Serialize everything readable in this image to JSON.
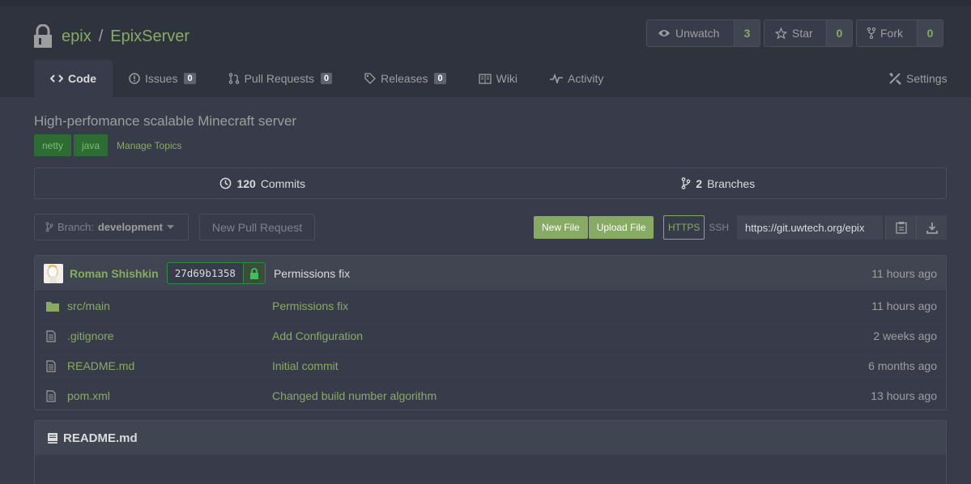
{
  "repo": {
    "owner": "epix",
    "separator": "/",
    "name": "EpixServer"
  },
  "actions": {
    "watch": {
      "label": "Unwatch",
      "count": "3"
    },
    "star": {
      "label": "Star",
      "count": "0"
    },
    "fork": {
      "label": "Fork",
      "count": "0"
    }
  },
  "tabs": [
    {
      "label": "Code"
    },
    {
      "label": "Issues",
      "badge": "0"
    },
    {
      "label": "Pull Requests",
      "badge": "0"
    },
    {
      "label": "Releases",
      "badge": "0"
    },
    {
      "label": "Wiki"
    },
    {
      "label": "Activity"
    },
    {
      "label": "Settings"
    }
  ],
  "description": "High-perfomance scalable Minecraft server",
  "topics": [
    "netty",
    "java"
  ],
  "manage_topics": "Manage Topics",
  "stats": {
    "commits_count": "120",
    "commits_label": "Commits",
    "branches_count": "2",
    "branches_label": "Branches"
  },
  "branch": {
    "prefix": "Branch:",
    "name": "development"
  },
  "new_pull_request": "New Pull Request",
  "file_buttons": {
    "new_file": "New File",
    "upload_file": "Upload File"
  },
  "clone": {
    "https": "HTTPS",
    "ssh": "SSH",
    "url": "https://git.uwtech.org/epix"
  },
  "latest_commit": {
    "author": "Roman Shishkin",
    "sha": "27d69b1358",
    "message": "Permissions fix",
    "time": "11 hours ago"
  },
  "files": [
    {
      "type": "folder",
      "name": "src/main",
      "message": "Permissions fix",
      "time": "11 hours ago"
    },
    {
      "type": "file",
      "name": ".gitignore",
      "message": "Add Configuration",
      "time": "2 weeks ago"
    },
    {
      "type": "file",
      "name": "README.md",
      "message": "Initial commit",
      "time": "6 months ago"
    },
    {
      "type": "file",
      "name": "pom.xml",
      "message": "Changed build number algorithm",
      "time": "13 hours ago"
    }
  ],
  "readme": {
    "title": "README.md"
  },
  "colors": {
    "accent": "#87ab63",
    "background": "#383c4a",
    "header": "#2f333e"
  }
}
